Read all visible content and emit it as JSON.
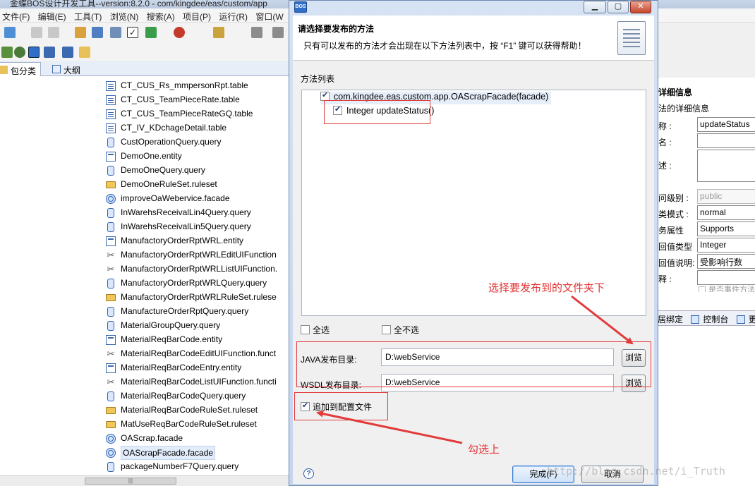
{
  "ide": {
    "title": "金蝶BOS设计开发工具--version:8.2.0 - com/kingdee/eas/custom/app",
    "menu": [
      "文件(F)",
      "编辑(E)",
      "工具(T)",
      "浏览(N)",
      "搜索(A)",
      "项目(P)",
      "运行(R)",
      "窗口(W"
    ],
    "tabs": {
      "package_tab": "包分类",
      "outline_tab": "大纲"
    },
    "tree_items": [
      {
        "label": "CT_CUS_Rs_mmpersonRpt.table",
        "icon": "table-icon"
      },
      {
        "label": "CT_CUS_TeamPieceRate.table",
        "icon": "table-icon"
      },
      {
        "label": "CT_CUS_TeamPieceRateGQ.table",
        "icon": "table-icon"
      },
      {
        "label": "CT_IV_KDchageDetail.table",
        "icon": "table-icon"
      },
      {
        "label": "CustOperationQuery.query",
        "icon": "query-icon"
      },
      {
        "label": "DemoOne.entity",
        "icon": "entity-icon"
      },
      {
        "label": "DemoOneQuery.query",
        "icon": "query-icon"
      },
      {
        "label": "DemoOneRuleSet.ruleset",
        "icon": "ruleset-icon"
      },
      {
        "label": "improveOaWeberviсe.facade",
        "icon": "facade-icon"
      },
      {
        "label": "InWarehsReceivalLin4Query.query",
        "icon": "query-icon"
      },
      {
        "label": "InWarehsReceivalLin5Query.query",
        "icon": "query-icon"
      },
      {
        "label": "ManufactoryOrderRptWRL.entity",
        "icon": "entity-icon"
      },
      {
        "label": "ManufactoryOrderRptWRLEditUIFunction",
        "icon": "function-icon"
      },
      {
        "label": "ManufactoryOrderRptWRLListUIFunction.",
        "icon": "function-icon"
      },
      {
        "label": "ManufactoryOrderRptWRLQuery.query",
        "icon": "query-icon"
      },
      {
        "label": "ManufactoryOrderRptWRLRuleSet.rulese",
        "icon": "ruleset-icon"
      },
      {
        "label": "ManufactureOrderRptQuery.query",
        "icon": "query-icon"
      },
      {
        "label": "MaterialGroupQuery.query",
        "icon": "query-icon"
      },
      {
        "label": "MaterialReqBarCode.entity",
        "icon": "entity-icon"
      },
      {
        "label": "MaterialReqBarCodeEditUIFunction.funct",
        "icon": "function-icon"
      },
      {
        "label": "MaterialReqBarCodeEntry.entity",
        "icon": "entity-icon"
      },
      {
        "label": "MaterialReqBarCodeListUIFunction.functi",
        "icon": "function-icon"
      },
      {
        "label": "MaterialReqBarCodeQuery.query",
        "icon": "query-icon"
      },
      {
        "label": "MaterialReqBarCodeRuleSet.ruleset",
        "icon": "ruleset-icon"
      },
      {
        "label": "MatUseReqBarCodeRuleSet.ruleset",
        "icon": "ruleset-icon"
      },
      {
        "label": "OAScrap.facade",
        "icon": "facade-icon"
      },
      {
        "label": "OAScrapFacade.facade",
        "icon": "facade-icon",
        "selected": true
      },
      {
        "label": "packageNumberF7Query.query",
        "icon": "query-icon"
      }
    ],
    "scroll_thumb": "|||"
  },
  "right_panel": {
    "title": "详细信息",
    "subtitle": "法的详细信息",
    "rows": [
      {
        "label": "称 :",
        "value": "updateStatus",
        "disabled": false
      },
      {
        "label": "名 :",
        "value": "",
        "disabled": false
      },
      {
        "label": "述 :",
        "value": "",
        "disabled": false,
        "tall": true
      },
      {
        "label": "问级别 :",
        "value": "public",
        "disabled": true
      },
      {
        "label": "类模式 :",
        "value": "normal",
        "disabled": false
      },
      {
        "label": "务属性",
        "value": "Supports",
        "disabled": false
      },
      {
        "label": "回值类型",
        "value": "Integer",
        "disabled": false
      },
      {
        "label": "回值说明:",
        "value": "受影响行数",
        "disabled": false
      },
      {
        "label": "释 :",
        "value": "",
        "disabled": false
      }
    ],
    "checkbox_label": "是否事件方法",
    "tabs": [
      "居绑定",
      "控制台",
      "更"
    ]
  },
  "dialog": {
    "logo": "BOS",
    "heading": "请选择要发布的方法",
    "description": "只有可以发布的方法才会出现在以下方法列表中，按 “F1” 键可以获得帮助！",
    "list_label": "方法列表",
    "methods": {
      "facade": "com.kingdee.eas.custom.app.OAScrapFacade(facade)",
      "method": "Integer updateStatus()"
    },
    "select_all": "全选",
    "deselect_all": "全不选",
    "java_dir_label": "JAVA发布目录:",
    "java_dir_value": "D:\\webService",
    "wsdl_dir_label": "WSDL发布目录:",
    "wsdl_dir_value": "D:\\webService",
    "browse": "浏览",
    "append_config": "追加到配置文件",
    "finish": "完成(F)",
    "cancel": "取消"
  },
  "annotations": {
    "folder_note": "选择要发布到的文件夹下",
    "check_note": "勾选上",
    "watermark": "http://blog.csdn.net/i_Truth"
  },
  "colors": {
    "annotation_red": "#e23a3a",
    "dialog_frame": "#c4d5ee"
  }
}
